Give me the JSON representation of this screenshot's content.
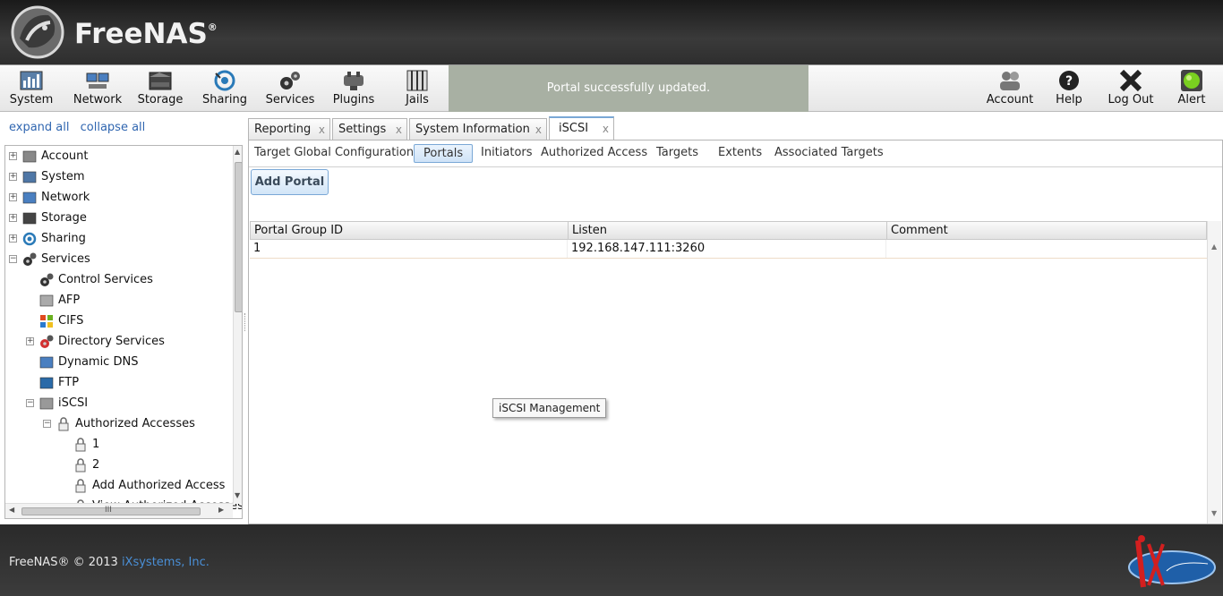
{
  "app": {
    "name": "FreeNAS"
  },
  "toolbar": {
    "left_items": [
      {
        "label": "System",
        "icon": "system-icon"
      },
      {
        "label": "Network",
        "icon": "network-icon"
      },
      {
        "label": "Storage",
        "icon": "storage-icon"
      },
      {
        "label": "Sharing",
        "icon": "sharing-icon"
      },
      {
        "label": "Services",
        "icon": "services-icon"
      },
      {
        "label": "Plugins",
        "icon": "plugins-icon"
      },
      {
        "label": "Jails",
        "icon": "jails-icon"
      }
    ],
    "notice": "Portal successfully updated.",
    "right_items": [
      {
        "label": "Account",
        "icon": "account-icon"
      },
      {
        "label": "Help",
        "icon": "help-icon"
      },
      {
        "label": "Log Out",
        "icon": "logout-icon"
      },
      {
        "label": "Alert",
        "icon": "alert-icon"
      }
    ]
  },
  "sidebar": {
    "expand_all": "expand all",
    "collapse_all": "collapse all",
    "tree": [
      {
        "label": "Account",
        "expander": "+",
        "icon": "account-icon"
      },
      {
        "label": "System",
        "expander": "+",
        "icon": "system-icon"
      },
      {
        "label": "Network",
        "expander": "+",
        "icon": "network-icon"
      },
      {
        "label": "Storage",
        "expander": "+",
        "icon": "storage-icon"
      },
      {
        "label": "Sharing",
        "expander": "+",
        "icon": "sharing-icon"
      },
      {
        "label": "Services",
        "expander": "−",
        "icon": "services-icon"
      },
      {
        "label": "Control Services",
        "expander": "",
        "icon": "control-services-icon"
      },
      {
        "label": "AFP",
        "expander": "",
        "icon": "apple-icon"
      },
      {
        "label": "CIFS",
        "expander": "",
        "icon": "windows-icon"
      },
      {
        "label": "Directory Services",
        "expander": "+",
        "icon": "directory-services-icon"
      },
      {
        "label": "Dynamic DNS",
        "expander": "",
        "icon": "dynamic-dns-icon"
      },
      {
        "label": "FTP",
        "expander": "",
        "icon": "ftp-icon"
      },
      {
        "label": "iSCSI",
        "expander": "−",
        "icon": "iscsi-icon"
      },
      {
        "label": "Authorized Accesses",
        "expander": "−",
        "icon": "lock-icon"
      },
      {
        "label": "1",
        "expander": "",
        "icon": "lock-icon"
      },
      {
        "label": "2",
        "expander": "",
        "icon": "lock-icon"
      },
      {
        "label": "Add Authorized Access",
        "expander": "",
        "icon": "lock-add-icon"
      },
      {
        "label": "View Authorized Accesses",
        "expander": "",
        "icon": "lock-view-icon"
      }
    ],
    "hscroll_grip": "III"
  },
  "tabs": [
    {
      "label": "Reporting",
      "close": "x"
    },
    {
      "label": "Settings",
      "close": "x"
    },
    {
      "label": "System Information",
      "close": "x"
    },
    {
      "label": "iSCSI",
      "close": "x"
    }
  ],
  "subtabs": [
    "Target Global Configuration",
    "Portals",
    "Initiators",
    "Authorized Access",
    "Targets",
    "Extents",
    "Associated Targets"
  ],
  "add_portal": "Add Portal",
  "grid": {
    "columns": [
      "Portal Group ID",
      "Listen",
      "Comment"
    ],
    "rows": [
      [
        "1",
        "192.168.147.111:3260",
        ""
      ]
    ]
  },
  "tooltip": "iSCSI Management",
  "footer": {
    "copyright": "FreeNAS® © 2013 ",
    "company": "iXsystems, Inc."
  },
  "colors": {
    "accent": "#7aa8d6",
    "notice_bg": "#a8b0a3",
    "link": "#3066b0"
  }
}
